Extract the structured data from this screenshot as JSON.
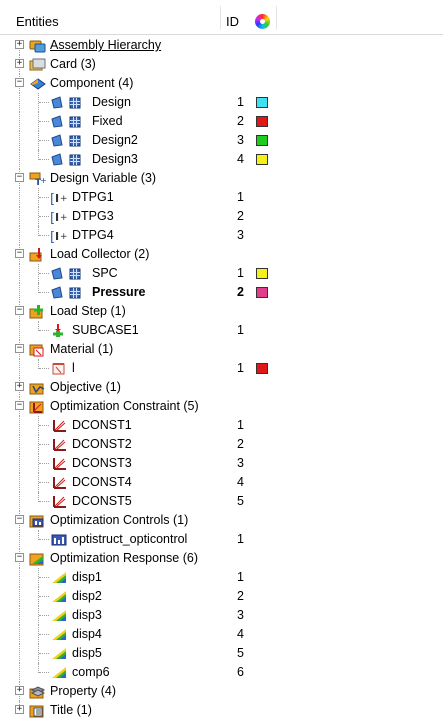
{
  "header": {
    "entities": "Entities",
    "id": "ID",
    "color_icon": "color-wheel-icon"
  },
  "tree": {
    "assembly": {
      "label": "Assembly Hierarchy",
      "expander": "+"
    },
    "card": {
      "label": "Card (3)",
      "expander": "+"
    },
    "component": {
      "label": "Component (4)",
      "expander": "−",
      "items": [
        {
          "label": "Design",
          "id": "1",
          "color": "#3fe0f0"
        },
        {
          "label": "Fixed",
          "id": "2",
          "color": "#e01818"
        },
        {
          "label": "Design2",
          "id": "3",
          "color": "#1ecc1e"
        },
        {
          "label": "Design3",
          "id": "4",
          "color": "#f4f01a"
        }
      ]
    },
    "design_variable": {
      "label": "Design Variable (3)",
      "expander": "−",
      "items": [
        {
          "label": "DTPG1",
          "id": "1"
        },
        {
          "label": "DTPG3",
          "id": "2"
        },
        {
          "label": "DTPG4",
          "id": "3"
        }
      ]
    },
    "load_collector": {
      "label": "Load Collector (2)",
      "expander": "−",
      "items": [
        {
          "label": "SPC",
          "id": "1",
          "color": "#f4f01a"
        },
        {
          "label": "Pressure",
          "id": "2",
          "color": "#e23c8c"
        }
      ]
    },
    "load_step": {
      "label": "Load Step (1)",
      "expander": "−",
      "items": [
        {
          "label": "SUBCASE1",
          "id": "1"
        }
      ]
    },
    "material": {
      "label": "Material (1)",
      "expander": "−",
      "items": [
        {
          "label": "l",
          "id": "1",
          "color": "#e01818"
        }
      ]
    },
    "objective": {
      "label": "Objective (1)",
      "expander": "+"
    },
    "opt_constraint": {
      "label": "Optimization Constraint (5)",
      "expander": "−",
      "items": [
        {
          "label": "DCONST1",
          "id": "1"
        },
        {
          "label": "DCONST2",
          "id": "2"
        },
        {
          "label": "DCONST3",
          "id": "3"
        },
        {
          "label": "DCONST4",
          "id": "4"
        },
        {
          "label": "DCONST5",
          "id": "5"
        }
      ]
    },
    "opt_controls": {
      "label": "Optimization Controls (1)",
      "expander": "−",
      "items": [
        {
          "label": "optistruct_opticontrol",
          "id": "1"
        }
      ]
    },
    "opt_response": {
      "label": "Optimization Response (6)",
      "expander": "−",
      "items": [
        {
          "label": "disp1",
          "id": "1"
        },
        {
          "label": "disp2",
          "id": "2"
        },
        {
          "label": "disp3",
          "id": "3"
        },
        {
          "label": "disp4",
          "id": "4"
        },
        {
          "label": "disp5",
          "id": "5"
        },
        {
          "label": "comp6",
          "id": "6"
        }
      ]
    },
    "property": {
      "label": "Property (4)",
      "expander": "+"
    },
    "title": {
      "label": "Title (1)",
      "expander": "+"
    }
  }
}
